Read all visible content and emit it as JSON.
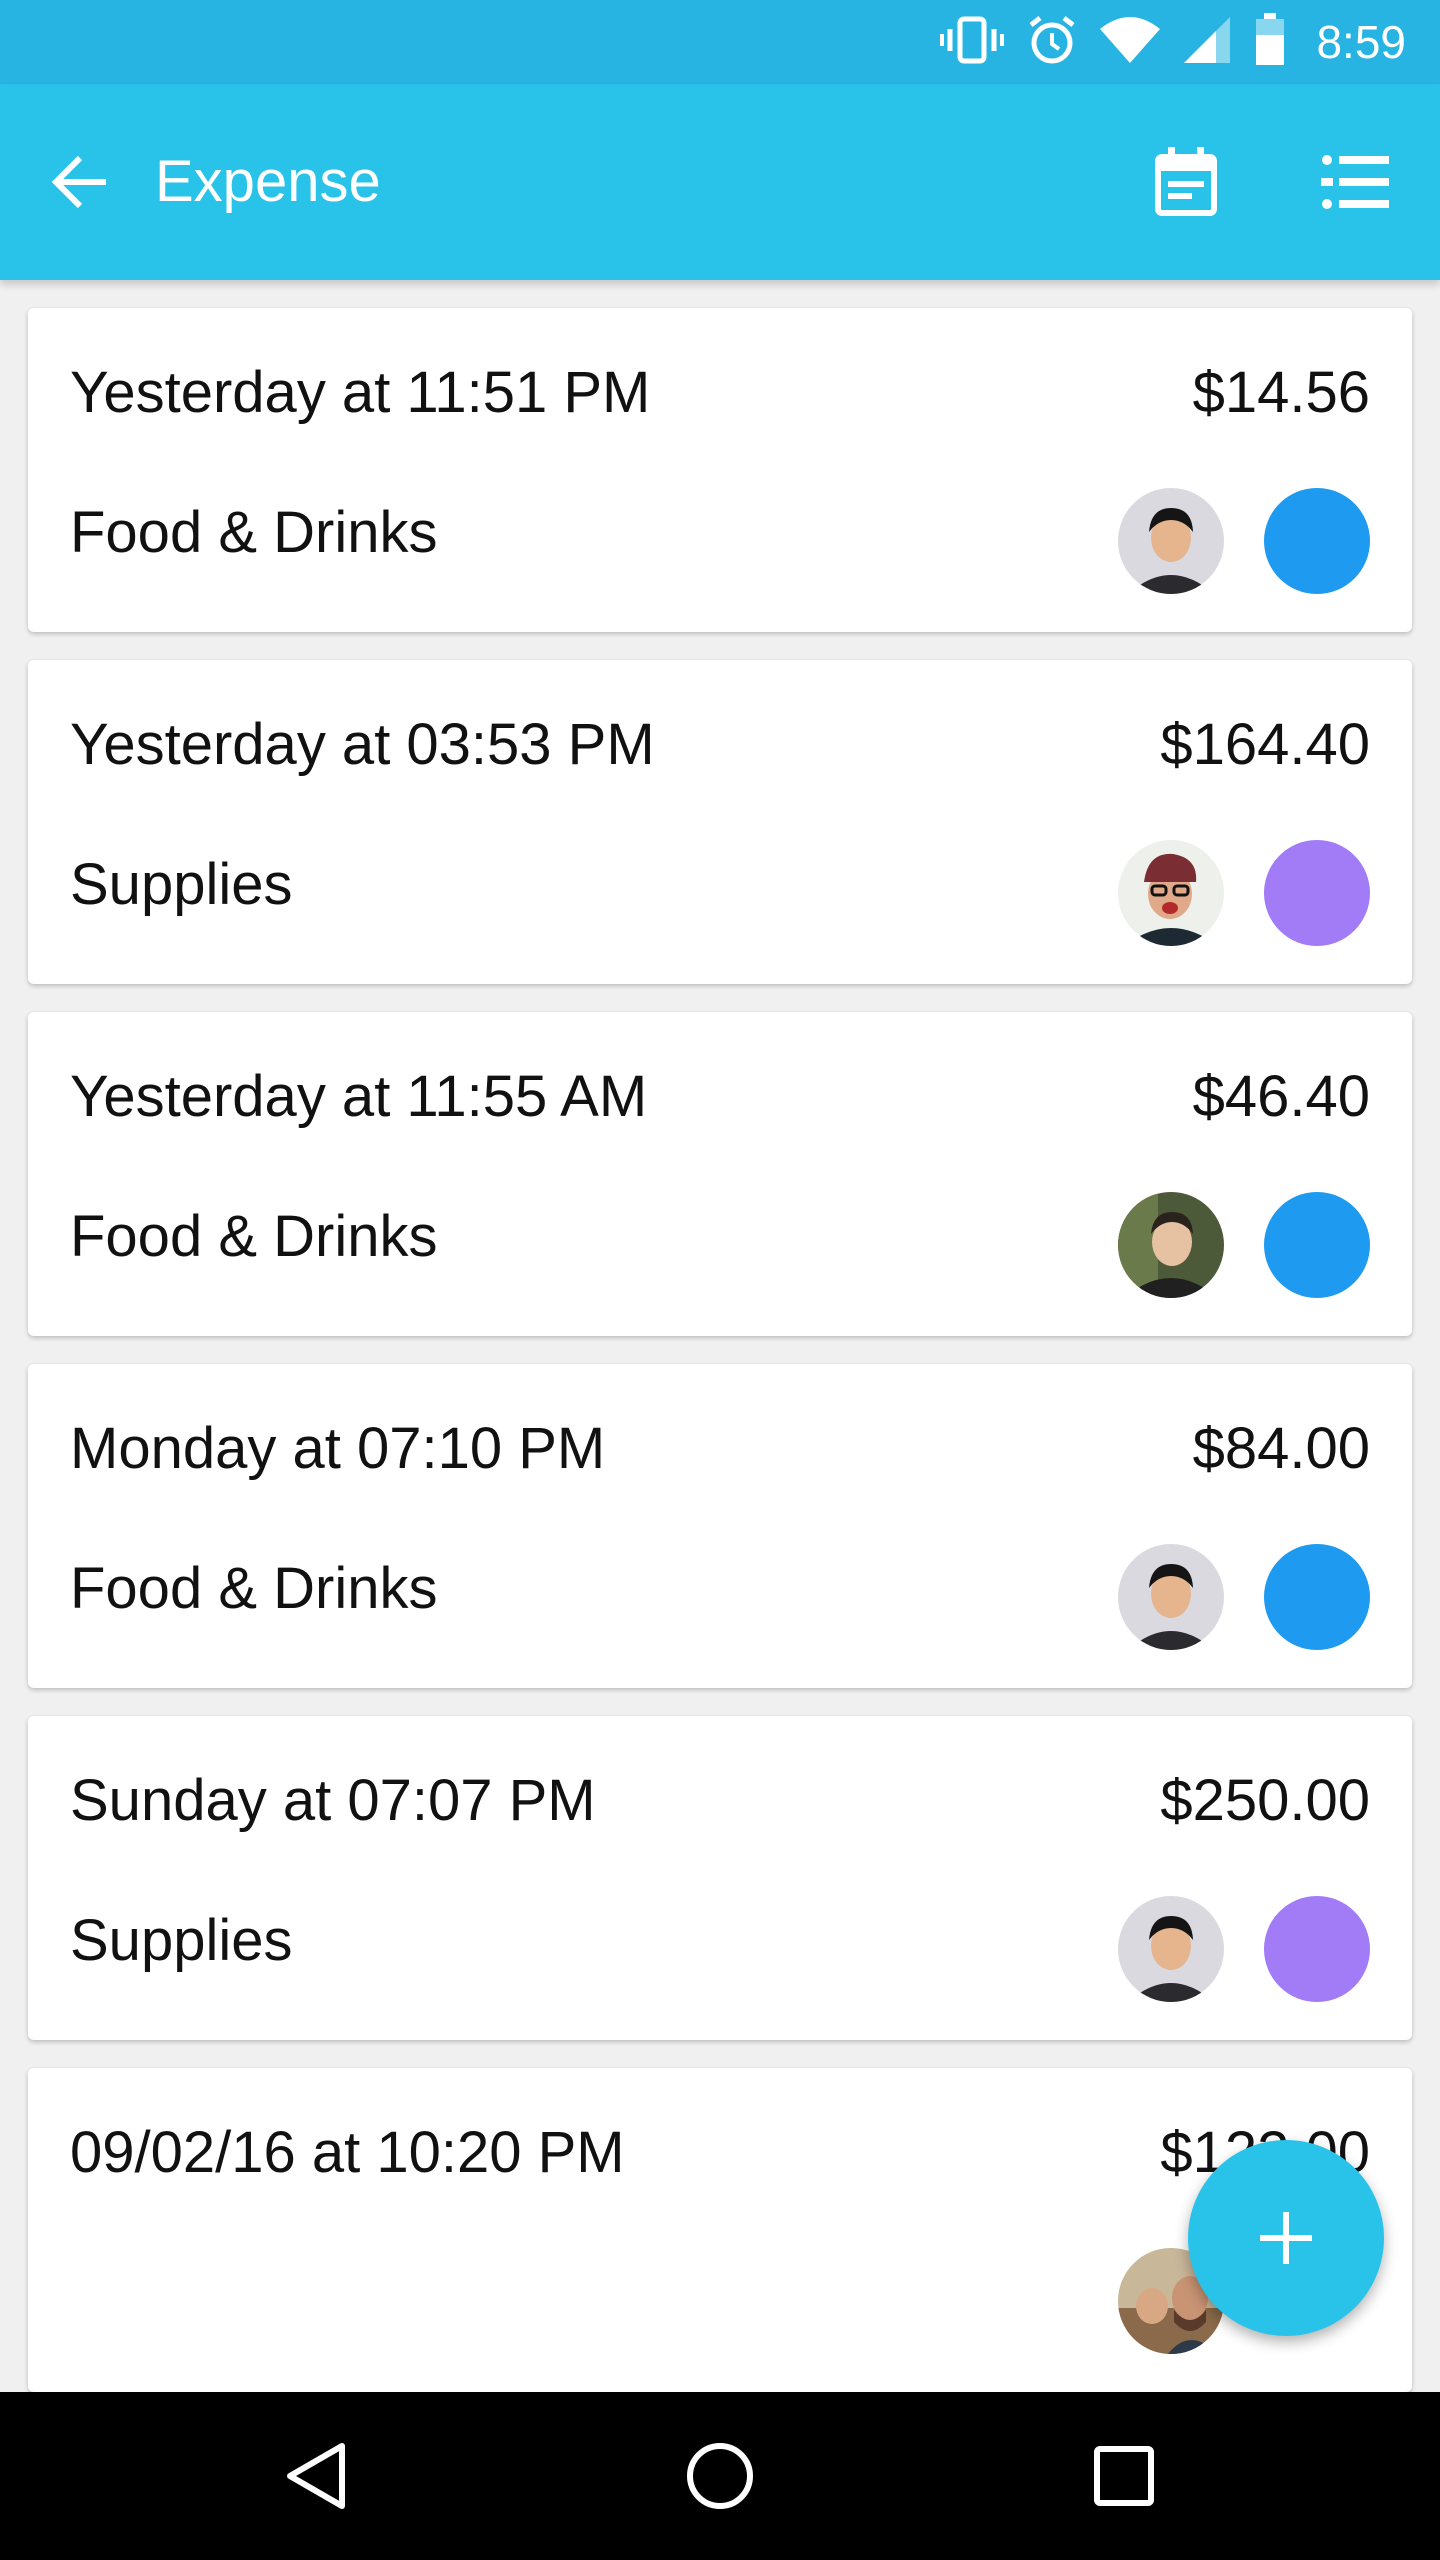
{
  "status_bar": {
    "time": "8:59",
    "icons": [
      "vibrate-icon",
      "alarm-icon",
      "wifi-icon",
      "signal-icon",
      "battery-icon"
    ]
  },
  "app_bar": {
    "title": "Expense",
    "back_icon": "arrow-back-icon",
    "actions": [
      "calendar-icon",
      "list-view-icon"
    ]
  },
  "expenses": [
    {
      "date": "Yesterday at 11:51 PM",
      "amount": "$14.56",
      "category": "Food & Drinks",
      "category_color": "#1e9bf0",
      "avatar": "avatar-person-1"
    },
    {
      "date": "Yesterday at 03:53 PM",
      "amount": "$164.40",
      "category": "Supplies",
      "category_color": "#a17cf6",
      "avatar": "avatar-person-2"
    },
    {
      "date": "Yesterday at 11:55 AM",
      "amount": "$46.40",
      "category": "Food & Drinks",
      "category_color": "#1e9bf0",
      "avatar": "avatar-person-3"
    },
    {
      "date": "Monday at 07:10 PM",
      "amount": "$84.00",
      "category": "Food & Drinks",
      "category_color": "#1e9bf0",
      "avatar": "avatar-person-1"
    },
    {
      "date": "Sunday at 07:07 PM",
      "amount": "$250.00",
      "category": "Supplies",
      "category_color": "#a17cf6",
      "avatar": "avatar-person-1"
    },
    {
      "date": "09/02/16 at 10:20 PM",
      "amount": "$122.00",
      "category": "",
      "category_color": "",
      "avatar": "avatar-person-4"
    }
  ],
  "fab": {
    "icon": "add-icon"
  },
  "nav_bar": {
    "icons": [
      "back-triangle-icon",
      "home-circle-icon",
      "recents-square-icon"
    ]
  },
  "colors": {
    "status_bar": "#28b4e2",
    "app_bar": "#29c3ea",
    "accent": "#29c3ea"
  }
}
